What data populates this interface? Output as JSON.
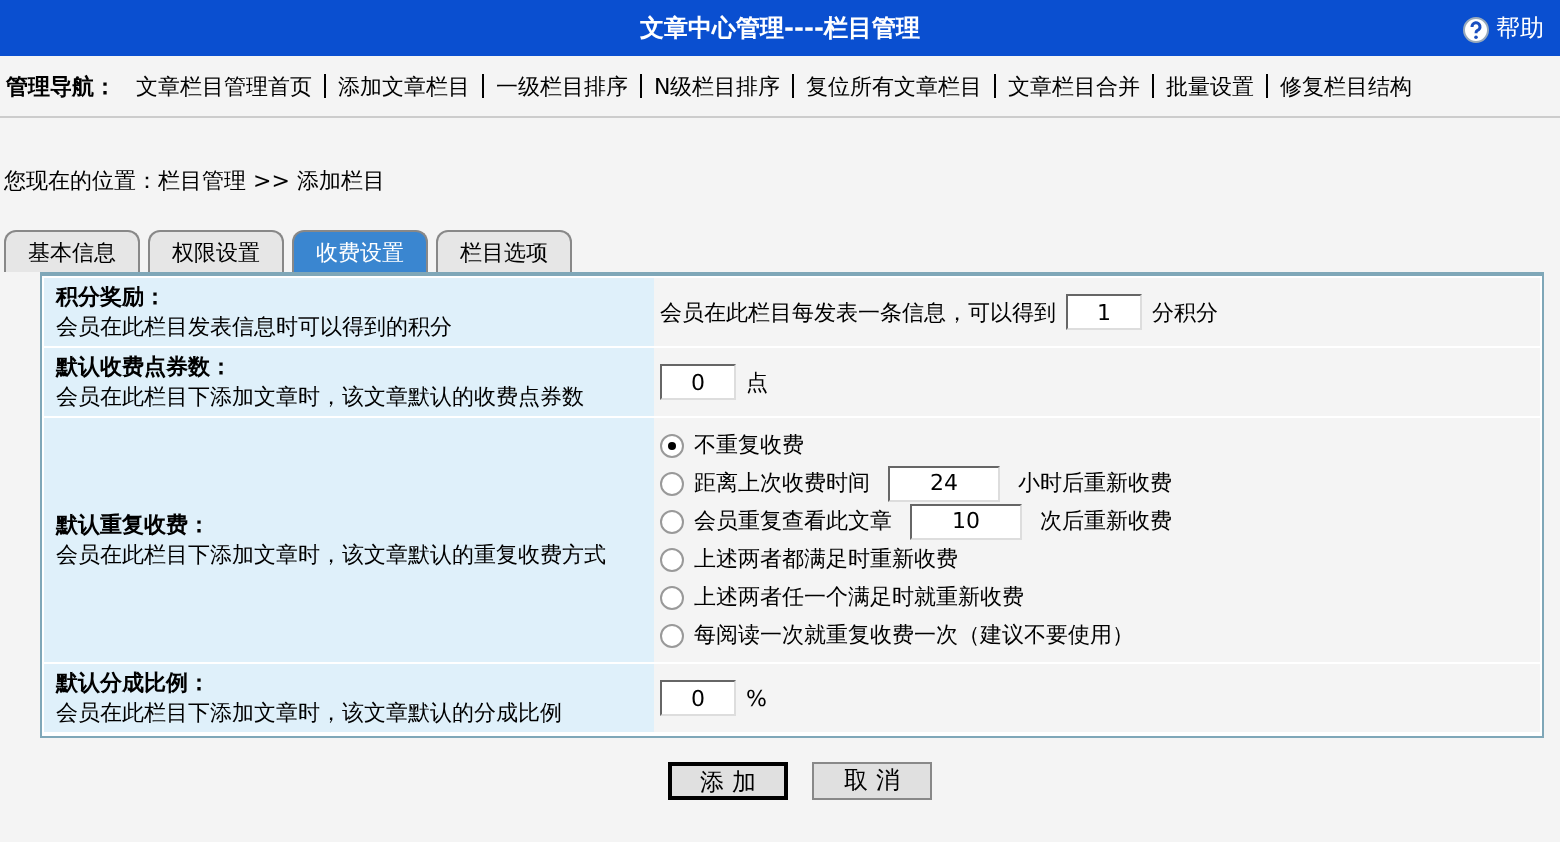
{
  "header": {
    "title": "文章中心管理----栏目管理",
    "help": "帮助"
  },
  "nav": {
    "label": "管理导航：",
    "items": [
      "文章栏目管理首页",
      "添加文章栏目",
      "一级栏目排序",
      "N级栏目排序",
      "复位所有文章栏目",
      "文章栏目合并",
      "批量设置",
      "修复栏目结构"
    ]
  },
  "breadcrumb": "您现在的位置：栏目管理 >> 添加栏目",
  "tabs": [
    {
      "label": "基本信息",
      "selected": false
    },
    {
      "label": "权限设置",
      "selected": false
    },
    {
      "label": "收费设置",
      "selected": true
    },
    {
      "label": "栏目选项",
      "selected": false
    }
  ],
  "rows": [
    {
      "title": "积分奖励：",
      "desc": "会员在此栏目发表信息时可以得到的积分",
      "kind": "input",
      "before": "会员在此栏目每发表一条信息，可以得到",
      "value": "1",
      "after": "分积分"
    },
    {
      "title": "默认收费点券数：",
      "desc": "会员在此栏目下添加文章时，该文章默认的收费点券数",
      "kind": "input",
      "value": "0",
      "after": "点"
    },
    {
      "title": "默认重复收费：",
      "desc": "会员在此栏目下添加文章时，该文章默认的重复收费方式",
      "kind": "radios",
      "options": [
        {
          "label": "不重复收费",
          "selected": true
        },
        {
          "label": "距离上次收费时间",
          "selected": false,
          "value": "24",
          "after": "小时后重新收费"
        },
        {
          "label": "会员重复查看此文章",
          "selected": false,
          "value": "10",
          "after": "次后重新收费"
        },
        {
          "label": "上述两者都满足时重新收费",
          "selected": false
        },
        {
          "label": "上述两者任一个满足时就重新收费",
          "selected": false
        },
        {
          "label": "每阅读一次就重复收费一次（建议不要使用）",
          "selected": false
        }
      ]
    },
    {
      "title": "默认分成比例：",
      "desc": "会员在此栏目下添加文章时，该文章默认的分成比例",
      "kind": "input",
      "value": "0",
      "after": "%"
    }
  ],
  "buttons": [
    "添 加",
    "取 消"
  ]
}
